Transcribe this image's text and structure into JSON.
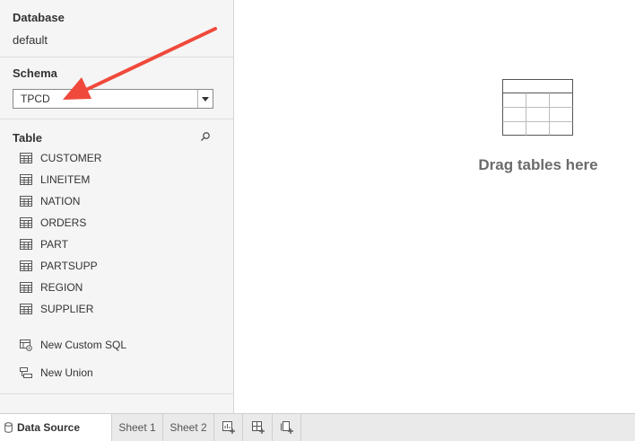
{
  "sidebar": {
    "database": {
      "title": "Database",
      "value": "default"
    },
    "schema": {
      "title": "Schema",
      "selected": "TPCD"
    },
    "tables": {
      "title": "Table",
      "items": [
        "CUSTOMER",
        "LINEITEM",
        "NATION",
        "ORDERS",
        "PART",
        "PARTSUPP",
        "REGION",
        "SUPPLIER"
      ]
    },
    "custom_sql": "New Custom SQL",
    "new_union": "New Union"
  },
  "canvas": {
    "drop_hint": "Drag tables here"
  },
  "tabs": {
    "data_source": "Data Source",
    "sheets": [
      "Sheet 1",
      "Sheet 2"
    ]
  },
  "colors": {
    "annotation_arrow": "#f0493b",
    "accent_text": "#333333"
  },
  "icons": {
    "table": "grid-icon",
    "search": "search-icon",
    "custom_sql": "custom-sql-icon",
    "union": "union-icon",
    "datasource": "database-icon",
    "new_sheet": "new-worksheet-icon",
    "new_dashboard": "new-dashboard-icon",
    "new_story": "new-story-icon"
  }
}
